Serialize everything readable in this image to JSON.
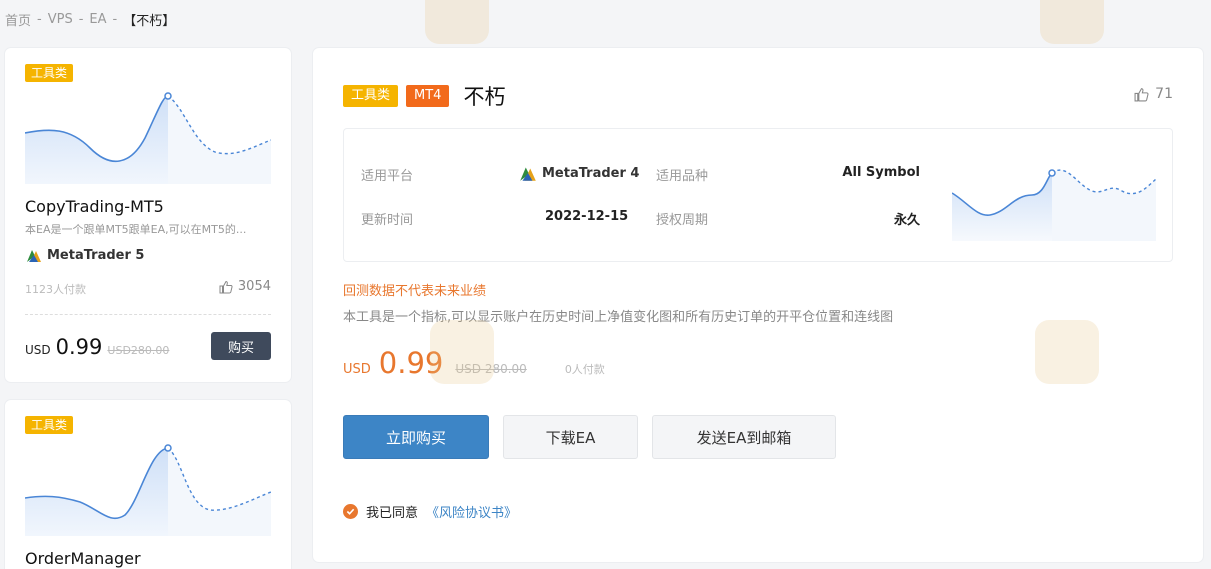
{
  "breadcrumb": {
    "home": "首页",
    "sep": "-",
    "vps": "VPS",
    "ea": "EA",
    "current": "【不朽】"
  },
  "left_cards": [
    {
      "tag": "工具类",
      "title": "CopyTrading-MT5",
      "desc": "本EA是一个跟单MT5跟单EA,可以在MT5的...",
      "platform": "MetaTrader 5",
      "paid": "1123人付款",
      "likes": "3054",
      "currency": "USD",
      "price": "0.99",
      "orig_price": "USD280.00",
      "buy_label": "购买"
    },
    {
      "tag": "工具类",
      "title": "OrderManager"
    }
  ],
  "main": {
    "tag_type": "工具类",
    "tag_platform": "MT4",
    "name": "不朽",
    "likes": "71",
    "info": {
      "platform_label": "适用平台",
      "platform_value": "MetaTrader 4",
      "symbol_label": "适用品种",
      "symbol_value": "All Symbol",
      "update_label": "更新时间",
      "update_value": "2022-12-15",
      "license_label": "授权周期",
      "license_value": "永久"
    },
    "warning": "回测数据不代表未来业绩",
    "desc": "本工具是一个指标,可以显示账户在历史时间上净值变化图和所有历史订单的开平仓位置和连线图",
    "currency": "USD",
    "price": "0.99",
    "orig_price": "USD 280.00",
    "paid": "0人付款",
    "buy_now": "立即购买",
    "download": "下载EA",
    "send_email": "发送EA到邮箱",
    "agree_text": "我已同意",
    "agree_link": "《风险协议书》"
  },
  "colors": {
    "accent_orange": "#e8772e",
    "primary_blue": "#3d85c6",
    "tag_yellow": "#f5b400",
    "tag_orange": "#f26a1b"
  }
}
